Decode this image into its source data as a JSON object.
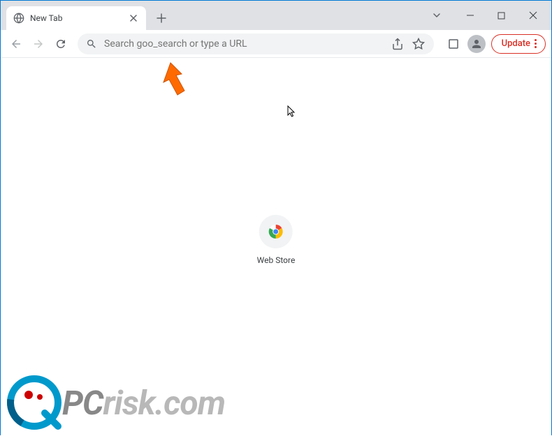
{
  "tab": {
    "title": "New Tab"
  },
  "omnibox": {
    "placeholder": "Search goo_search or type a URL"
  },
  "toolbar": {
    "update_label": "Update"
  },
  "shortcuts": [
    {
      "label": "Web Store"
    }
  ],
  "watermark": {
    "prefix": "PC",
    "suffix": "risk",
    "domain": ".com"
  }
}
